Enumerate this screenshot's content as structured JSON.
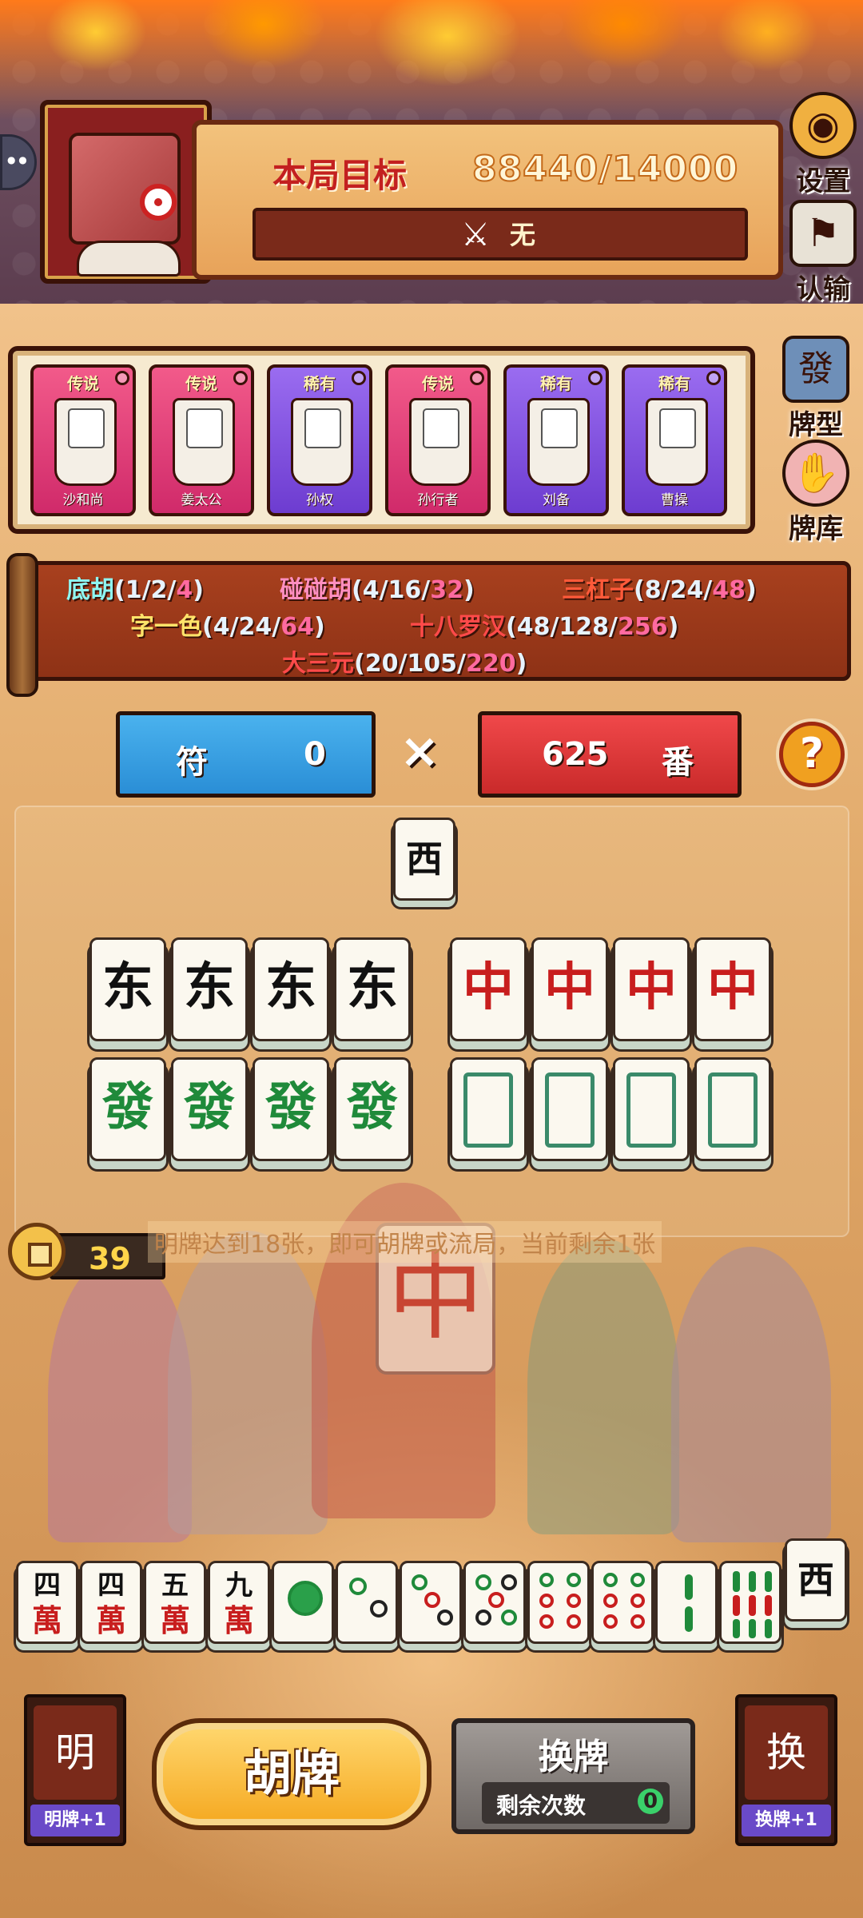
{
  "header": {
    "target_label": "本局目标",
    "target_value": "88440/14000",
    "target_status": "无"
  },
  "side": {
    "settings": "设置",
    "surrender": "认输",
    "patterns": "牌型",
    "library": "牌库"
  },
  "cards": [
    {
      "tier": "传说",
      "name": "沙和尚",
      "rarity": "legend"
    },
    {
      "tier": "传说",
      "name": "姜太公",
      "rarity": "legend"
    },
    {
      "tier": "稀有",
      "name": "孙权",
      "rarity": "rare"
    },
    {
      "tier": "传说",
      "name": "孙行者",
      "rarity": "legend"
    },
    {
      "tier": "稀有",
      "name": "刘备",
      "rarity": "rare"
    },
    {
      "tier": "稀有",
      "name": "曹操",
      "rarity": "rare"
    }
  ],
  "rules": {
    "dihu": {
      "name": "底胡",
      "detail": "(1/2/",
      "hi": "4",
      "end": ")"
    },
    "pengpenghu": {
      "name": "碰碰胡",
      "detail": "(4/16/",
      "hi": "32",
      "end": ")"
    },
    "sangangzi": {
      "name": "三杠子",
      "detail": "(8/24/",
      "hi": "48",
      "end": ")"
    },
    "ziyise": {
      "name": "字一色",
      "detail": "(4/24/",
      "hi": "64",
      "end": ")"
    },
    "shibaluohan": {
      "name": "十八罗汉",
      "detail": "(48/128/",
      "hi": "256",
      "end": ")"
    },
    "dasanyuan": {
      "name": "大三元",
      "detail": "(20/105/",
      "hi": "220",
      "end": ")"
    }
  },
  "score": {
    "fu_label": "符",
    "fu_value": "0",
    "times": "×",
    "fan_value": "625",
    "fan_label": "番",
    "help": "?"
  },
  "melds": {
    "top_tile": "西",
    "row1_left": [
      "东",
      "东",
      "东",
      "东"
    ],
    "row1_right": [
      "中",
      "中",
      "中",
      "中"
    ],
    "row2_left": [
      "發",
      "發",
      "發",
      "發"
    ],
    "row2_right_kind": "白板"
  },
  "coins": "39",
  "hint": "明牌达到18张，即可胡牌或流局，当前剩余1张",
  "hand": {
    "man": [
      {
        "top": "四",
        "bot": "萬"
      },
      {
        "top": "四",
        "bot": "萬"
      },
      {
        "top": "五",
        "bot": "萬"
      },
      {
        "top": "九",
        "bot": "萬"
      }
    ],
    "drawn": "西"
  },
  "actions": {
    "hu": "胡牌",
    "swap": "换牌",
    "swap_remaining_label": "剩余次数",
    "swap_remaining": "0",
    "boost_left_art": "明",
    "boost_left": "明牌+1",
    "boost_right_art": "换",
    "boost_right": "换牌+1"
  },
  "colors": {
    "fu": "#2a8ed6",
    "fan": "#c92a2a",
    "legend": "#d02a6a",
    "rare": "#6d3cd0"
  }
}
